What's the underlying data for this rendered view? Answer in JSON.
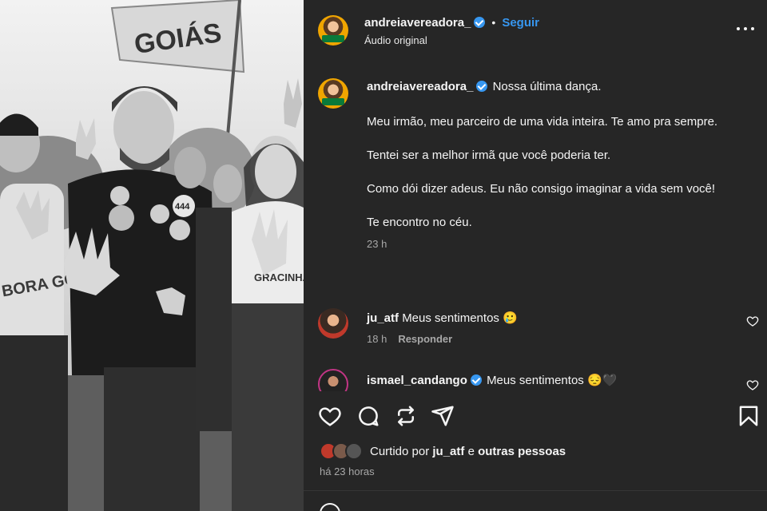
{
  "post": {
    "author": "andreiavereadora_",
    "follow_label": "Seguir",
    "separator": "•",
    "audio_label": "Áudio original",
    "media_banner_text": "GOIÁS",
    "shirt_text_left": "BORA GOIÁS!",
    "shirt_text_right": "GRACINHA CAIADO",
    "sticker_number": "444"
  },
  "caption": {
    "username": "andreiavereadora_",
    "first_line": "Nossa última dança.",
    "paragraphs": [
      "Meu irmão, meu parceiro de uma vida inteira. Te amo pra sempre.",
      "Tentei ser a melhor irmã que você poderia ter.",
      "Como dói dizer adeus. Eu não consigo imaginar a vida sem você!",
      "Te encontro no céu."
    ],
    "time": "23 h"
  },
  "comments": [
    {
      "username": "ju_atf",
      "text": "Meus sentimentos 🥲",
      "time": "18 h",
      "reply_label": "Responder",
      "verified": false
    },
    {
      "username": "ismael_candango",
      "text": "Meus sentimentos 😔🖤",
      "verified": true
    }
  ],
  "likes": {
    "prefix": "Curtido por",
    "user": "ju_atf",
    "joiner": "e",
    "others": "outras pessoas",
    "ago": "há 23 horas"
  },
  "icons": {
    "like": "heart-icon",
    "comment": "comment-icon",
    "repost": "repost-icon",
    "share": "share-icon",
    "save": "bookmark-icon",
    "more": "more-icon"
  },
  "colors": {
    "panel_bg": "#262626",
    "accent": "#3797f0",
    "muted": "#a8a8a8"
  }
}
